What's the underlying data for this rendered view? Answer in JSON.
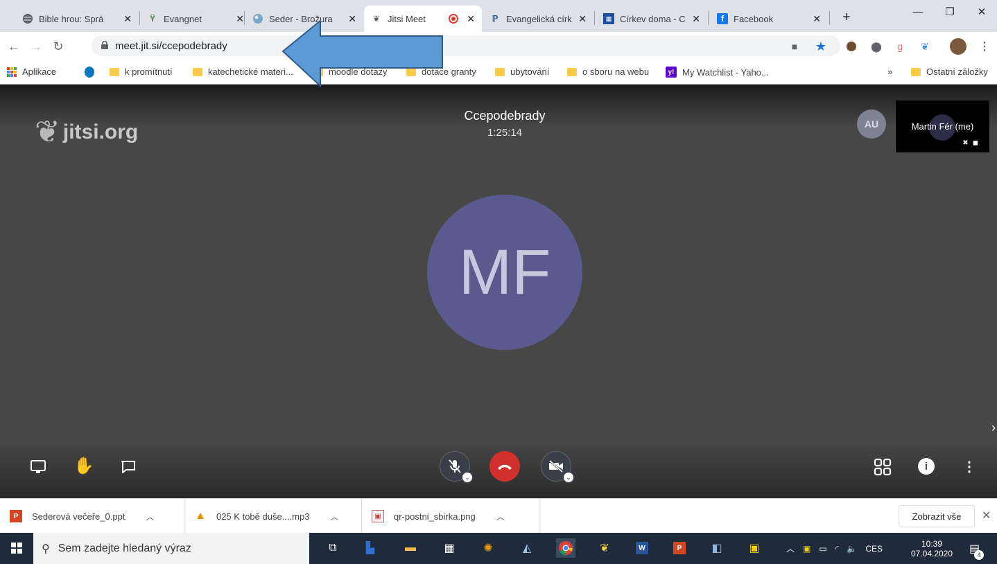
{
  "tabs": [
    {
      "title": "Bible hrou: Sprá",
      "icon": "globe-icon"
    },
    {
      "title": "Evangnet",
      "icon": "chalice-icon"
    },
    {
      "title": "Seder - Brožura",
      "icon": "earth-icon"
    },
    {
      "title": "Jitsi Meet",
      "icon": "jitsi-icon",
      "recording": true
    },
    {
      "title": "Evangelická círk",
      "icon": "ecce-icon"
    },
    {
      "title": "Církev doma - C",
      "icon": "calendar-icon"
    },
    {
      "title": "Facebook",
      "icon": "facebook-icon"
    }
  ],
  "address": {
    "url": "meet.jit.si/ccepodebrady"
  },
  "bookmarks": [
    {
      "label": "Aplikace",
      "icon": "apps-icon"
    },
    {
      "label": "",
      "icon": "drupal-icon"
    },
    {
      "label": "k promítnutí",
      "icon": "folder-icon"
    },
    {
      "label": "katechetické materi...",
      "icon": "folder-icon"
    },
    {
      "label": "moodle dotazy",
      "icon": "folder-icon"
    },
    {
      "label": "dotace granty",
      "icon": "folder-icon"
    },
    {
      "label": "ubytování",
      "icon": "folder-icon"
    },
    {
      "label": "o sboru na webu",
      "icon": "folder-icon"
    },
    {
      "label": "My Watchlist - Yaho...",
      "icon": "yahoo-icon"
    }
  ],
  "bookmarks_more": "»",
  "bookmarks_other": "Ostatní záložky",
  "meeting": {
    "logo": "jitsi.org",
    "room_name": "Ccepodebrady",
    "duration": "1:25:14",
    "remote_initials": "AU",
    "local_name": "Martin Fér (me)",
    "main_initials": "MF",
    "avatar_color": "#5b5a8f"
  },
  "downloads": [
    {
      "name": "Sederová večeře_0.ppt",
      "icon": "powerpoint-icon"
    },
    {
      "name": "025 K tobě duše....mp3",
      "icon": "vlc-icon"
    },
    {
      "name": "qr-postni_sbirka.png",
      "icon": "image-icon"
    }
  ],
  "downloads_show_all": "Zobrazit vše",
  "taskbar": {
    "search_placeholder": "Sem zadejte hledaný výraz",
    "language": "CES",
    "time": "10:39",
    "date": "07.04.2020",
    "notifications": "4"
  },
  "colors": {
    "hangup": "#d0312d",
    "accent": "#1a73e8",
    "arrow": "#5b9bd5"
  }
}
